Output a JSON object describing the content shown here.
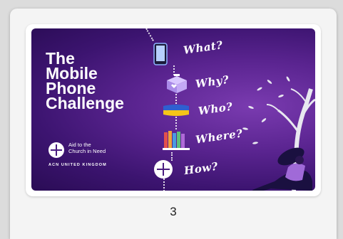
{
  "thumbnail": {
    "title_lines": [
      "The",
      "Mobile",
      "Phone",
      "Challenge"
    ],
    "org_name_lines": [
      "Aid to the",
      "Church in Need"
    ],
    "org_tagline": "ACN  UNITED KINGDOM",
    "questions": [
      "What?",
      "Why?",
      "Who?",
      "Where?",
      "How?"
    ]
  },
  "page_number": "3",
  "colors": {
    "card_bg": "#f4f4f4",
    "thumb_purple": "#5a2490",
    "flag_blue": "#2f5fd0",
    "flag_yellow": "#f5c518"
  }
}
